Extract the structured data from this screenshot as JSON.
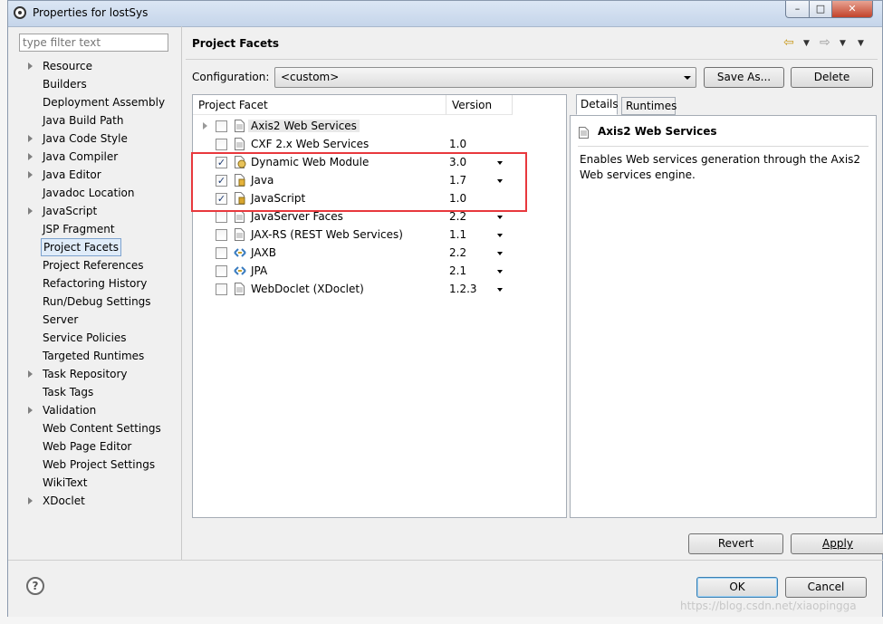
{
  "window": {
    "title": "Properties for lostSys"
  },
  "filter": {
    "placeholder": "type filter text"
  },
  "nav": {
    "items": [
      {
        "label": "Resource",
        "expandable": true
      },
      {
        "label": "Builders",
        "expandable": false
      },
      {
        "label": "Deployment Assembly",
        "expandable": false
      },
      {
        "label": "Java Build Path",
        "expandable": false
      },
      {
        "label": "Java Code Style",
        "expandable": true
      },
      {
        "label": "Java Compiler",
        "expandable": true
      },
      {
        "label": "Java Editor",
        "expandable": true
      },
      {
        "label": "Javadoc Location",
        "expandable": false
      },
      {
        "label": "JavaScript",
        "expandable": true
      },
      {
        "label": "JSP Fragment",
        "expandable": false
      },
      {
        "label": "Project Facets",
        "expandable": false,
        "selected": true
      },
      {
        "label": "Project References",
        "expandable": false
      },
      {
        "label": "Refactoring History",
        "expandable": false
      },
      {
        "label": "Run/Debug Settings",
        "expandable": false
      },
      {
        "label": "Server",
        "expandable": false
      },
      {
        "label": "Service Policies",
        "expandable": false
      },
      {
        "label": "Targeted Runtimes",
        "expandable": false
      },
      {
        "label": "Task Repository",
        "expandable": true
      },
      {
        "label": "Task Tags",
        "expandable": false
      },
      {
        "label": "Validation",
        "expandable": true
      },
      {
        "label": "Web Content Settings",
        "expandable": false
      },
      {
        "label": "Web Page Editor",
        "expandable": false
      },
      {
        "label": "Web Project Settings",
        "expandable": false
      },
      {
        "label": "WikiText",
        "expandable": false
      },
      {
        "label": "XDoclet",
        "expandable": true
      }
    ]
  },
  "page": {
    "title": "Project Facets"
  },
  "config": {
    "label": "Configuration:",
    "value": "<custom>",
    "save_as": "Save As...",
    "delete": "Delete"
  },
  "table": {
    "headers": {
      "facet": "Project Facet",
      "version": "Version"
    },
    "rows": [
      {
        "name": "Axis2 Web Services",
        "version": "",
        "checked": false,
        "expandable": true,
        "has_dropdown": false,
        "icon": "page-icon",
        "highlight": true
      },
      {
        "name": "CXF 2.x Web Services",
        "version": "1.0",
        "checked": false,
        "expandable": false,
        "has_dropdown": false,
        "icon": "page-icon"
      },
      {
        "name": "Dynamic Web Module",
        "version": "3.0",
        "checked": true,
        "expandable": false,
        "has_dropdown": true,
        "icon": "web-module-icon"
      },
      {
        "name": "Java",
        "version": "1.7",
        "checked": true,
        "expandable": false,
        "has_dropdown": true,
        "icon": "java-icon"
      },
      {
        "name": "JavaScript",
        "version": "1.0",
        "checked": true,
        "expandable": false,
        "has_dropdown": false,
        "icon": "javascript-icon"
      },
      {
        "name": "JavaServer Faces",
        "version": "2.2",
        "checked": false,
        "expandable": false,
        "has_dropdown": true,
        "icon": "page-icon"
      },
      {
        "name": "JAX-RS (REST Web Services)",
        "version": "1.1",
        "checked": false,
        "expandable": false,
        "has_dropdown": true,
        "icon": "page-icon"
      },
      {
        "name": "JAXB",
        "version": "2.2",
        "checked": false,
        "expandable": false,
        "has_dropdown": true,
        "icon": "jaxb-icon"
      },
      {
        "name": "JPA",
        "version": "2.1",
        "checked": false,
        "expandable": false,
        "has_dropdown": true,
        "icon": "jpa-icon"
      },
      {
        "name": "WebDoclet (XDoclet)",
        "version": "1.2.3",
        "checked": false,
        "expandable": false,
        "has_dropdown": true,
        "icon": "page-icon"
      }
    ]
  },
  "tabs": {
    "details": "Details",
    "runtimes": "Runtimes"
  },
  "details": {
    "title": "Axis2 Web Services",
    "description": "Enables Web services generation through the Axis2 Web services engine."
  },
  "buttons": {
    "revert": "Revert",
    "apply": "Apply",
    "ok": "OK",
    "cancel": "Cancel"
  },
  "watermark": "https://blog.csdn.net/xiaopingga",
  "colors": {
    "highlight_box": "#e8383d",
    "selection": "#e0ecf9"
  }
}
